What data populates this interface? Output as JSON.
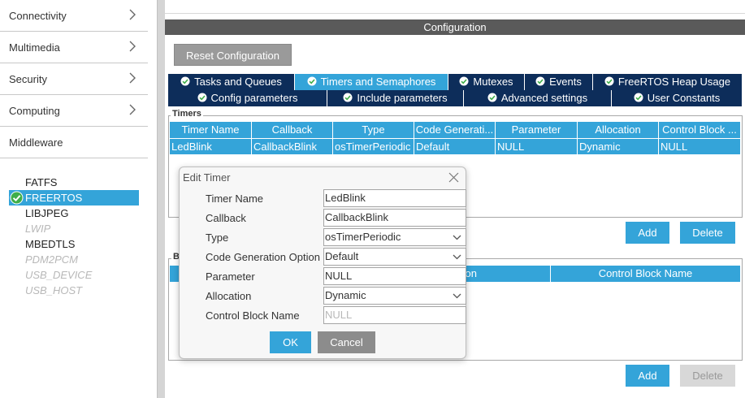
{
  "sidebar": {
    "categories": [
      {
        "label": "Connectivity"
      },
      {
        "label": "Multimedia"
      },
      {
        "label": "Security"
      },
      {
        "label": "Computing"
      },
      {
        "label": "Middleware"
      }
    ],
    "middleware_items": [
      {
        "label": "FATFS",
        "state": "normal"
      },
      {
        "label": "FREERTOS",
        "state": "selected"
      },
      {
        "label": "LIBJPEG",
        "state": "normal"
      },
      {
        "label": "LWIP",
        "state": "disabled"
      },
      {
        "label": "MBEDTLS",
        "state": "normal"
      },
      {
        "label": "PDM2PCM",
        "state": "disabled"
      },
      {
        "label": "USB_DEVICE",
        "state": "disabled"
      },
      {
        "label": "USB_HOST",
        "state": "disabled"
      }
    ]
  },
  "config": {
    "header": "Configuration",
    "reset_label": "Reset Configuration",
    "tabs_row1": [
      {
        "label": "Tasks and Queues",
        "active": false
      },
      {
        "label": "Timers and Semaphores",
        "active": true
      },
      {
        "label": "Mutexes",
        "active": false
      },
      {
        "label": "Events",
        "active": false
      },
      {
        "label": "FreeRTOS Heap Usage",
        "active": false
      }
    ],
    "tabs_row2": [
      {
        "label": "Config parameters"
      },
      {
        "label": "Include parameters"
      },
      {
        "label": "Advanced settings"
      },
      {
        "label": "User Constants"
      }
    ]
  },
  "timers": {
    "title": "Timers",
    "columns": [
      "Timer Name",
      "Callback",
      "Type",
      "Code Generati...",
      "Parameter",
      "Allocation",
      "Control Block ..."
    ],
    "rows": [
      [
        "LedBlink",
        "CallbackBlink",
        "osTimerPeriodic",
        "Default",
        "NULL",
        "Dynamic",
        "NULL"
      ]
    ],
    "add_label": "Add",
    "delete_label": "Delete"
  },
  "semaphores": {
    "title": "B",
    "columns_visible": [
      "ation",
      "Control Block Name"
    ],
    "add_label": "Add",
    "delete_label": "Delete"
  },
  "dialog": {
    "title": "Edit Timer",
    "fields": [
      {
        "label": "Timer Name",
        "value": "LedBlink",
        "dropdown": false
      },
      {
        "label": "Callback",
        "value": "CallbackBlink",
        "dropdown": false
      },
      {
        "label": "Type",
        "value": "osTimerPeriodic",
        "dropdown": true
      },
      {
        "label": "Code Generation Option",
        "value": "Default",
        "dropdown": true
      },
      {
        "label": "Parameter",
        "value": "NULL",
        "dropdown": false
      },
      {
        "label": "Allocation",
        "value": "Dynamic",
        "dropdown": true
      },
      {
        "label": "Control Block Name",
        "placeholder": "NULL",
        "dropdown": false
      }
    ],
    "ok_label": "OK",
    "cancel_label": "Cancel"
  },
  "colors": {
    "accent": "#34a4d9",
    "tab_dark": "#0d2d5a",
    "header_gray": "#5a5a5a",
    "check_green": "#3fae49"
  },
  "icons": {
    "chevron": "chevron-right-icon",
    "check": "check-circle-icon",
    "close": "close-icon",
    "dropdown": "chevron-down-icon"
  }
}
